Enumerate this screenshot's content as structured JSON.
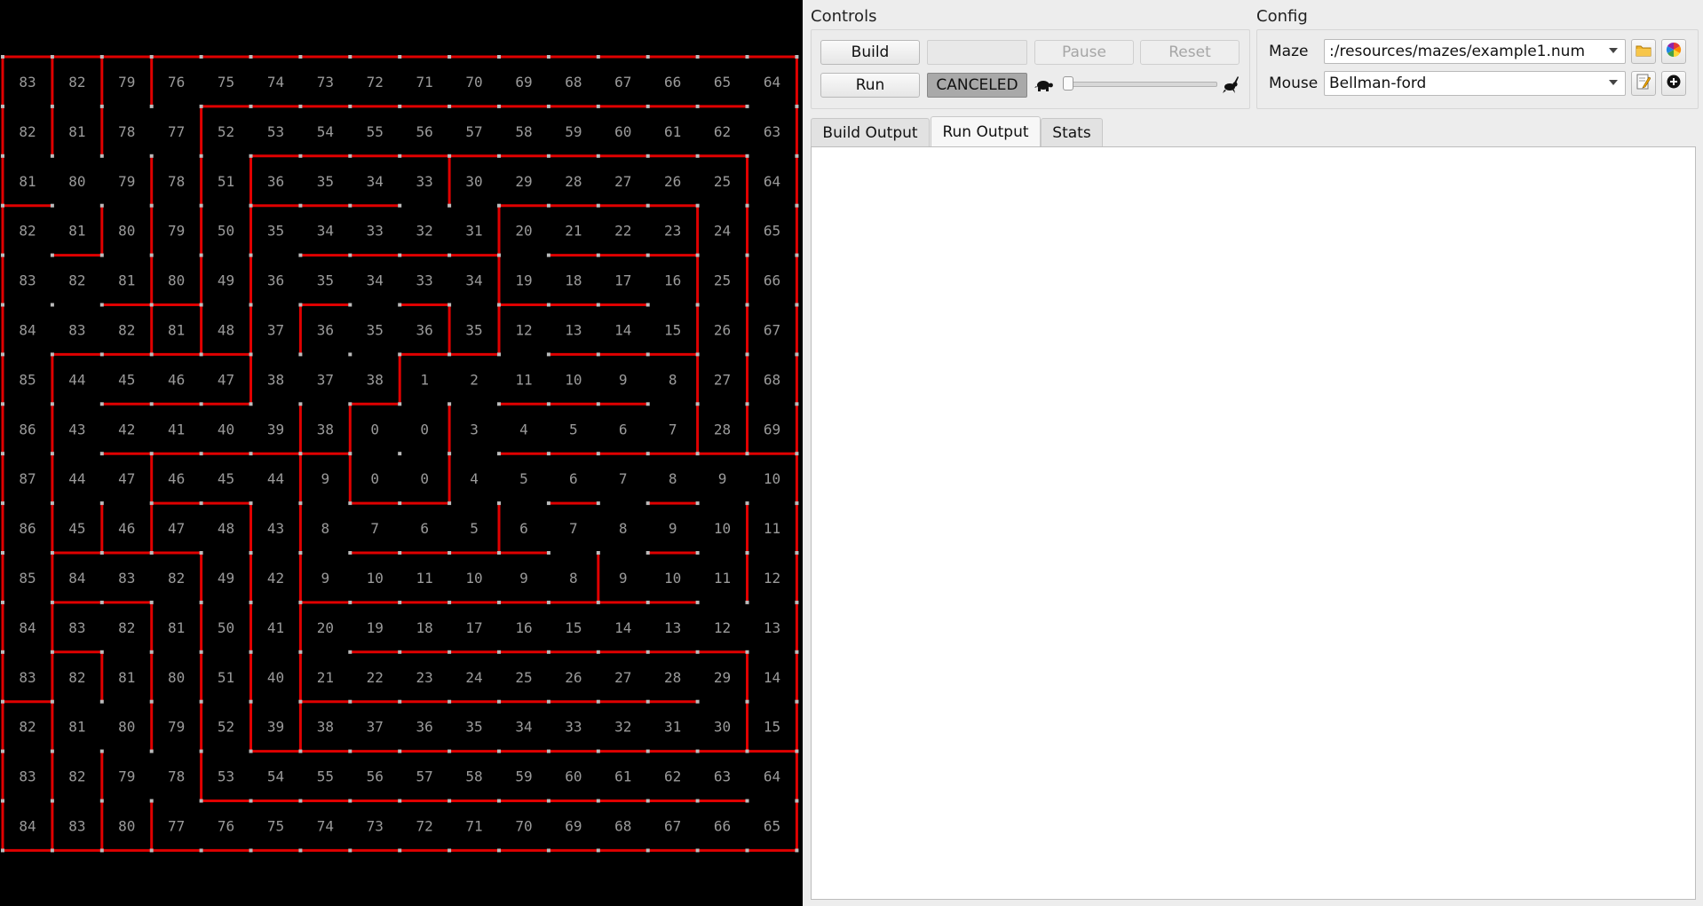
{
  "maze": {
    "rows": [
      [
        "83",
        "82",
        "79",
        "76",
        "75",
        "74",
        "73",
        "72",
        "71",
        "70",
        "69",
        "68",
        "67",
        "66",
        "65",
        "64"
      ],
      [
        "82",
        "81",
        "78",
        "77",
        "52",
        "53",
        "54",
        "55",
        "56",
        "57",
        "58",
        "59",
        "60",
        "61",
        "62",
        "63"
      ],
      [
        "81",
        "80",
        "79",
        "78",
        "51",
        "36",
        "35",
        "34",
        "33",
        "30",
        "29",
        "28",
        "27",
        "26",
        "25",
        "64"
      ],
      [
        "82",
        "81",
        "80",
        "79",
        "50",
        "35",
        "34",
        "33",
        "32",
        "31",
        "20",
        "21",
        "22",
        "23",
        "24",
        "65"
      ],
      [
        "83",
        "82",
        "81",
        "80",
        "49",
        "36",
        "35",
        "34",
        "33",
        "34",
        "19",
        "18",
        "17",
        "16",
        "25",
        "66"
      ],
      [
        "84",
        "83",
        "82",
        "81",
        "48",
        "37",
        "36",
        "35",
        "36",
        "35",
        "12",
        "13",
        "14",
        "15",
        "26",
        "67"
      ],
      [
        "85",
        "44",
        "45",
        "46",
        "47",
        "38",
        "37",
        "38",
        "1",
        "2",
        "11",
        "10",
        "9",
        "8",
        "27",
        "68"
      ],
      [
        "86",
        "43",
        "42",
        "41",
        "40",
        "39",
        "38",
        "0",
        "0",
        "3",
        "4",
        "5",
        "6",
        "7",
        "28",
        "69"
      ],
      [
        "87",
        "44",
        "47",
        "46",
        "45",
        "44",
        "9",
        "0",
        "0",
        "4",
        "5",
        "6",
        "7",
        "8",
        "9",
        "10"
      ],
      [
        "86",
        "45",
        "46",
        "47",
        "48",
        "43",
        "8",
        "7",
        "6",
        "5",
        "6",
        "7",
        "8",
        "9",
        "10",
        "11"
      ],
      [
        "85",
        "84",
        "83",
        "82",
        "49",
        "42",
        "9",
        "10",
        "11",
        "10",
        "9",
        "8",
        "9",
        "10",
        "11",
        "12"
      ],
      [
        "84",
        "83",
        "82",
        "81",
        "50",
        "41",
        "20",
        "19",
        "18",
        "17",
        "16",
        "15",
        "14",
        "13",
        "12",
        "13"
      ],
      [
        "83",
        "82",
        "81",
        "80",
        "51",
        "40",
        "21",
        "22",
        "23",
        "24",
        "25",
        "26",
        "27",
        "28",
        "29",
        "14"
      ],
      [
        "82",
        "81",
        "80",
        "79",
        "52",
        "39",
        "38",
        "37",
        "36",
        "35",
        "34",
        "33",
        "32",
        "31",
        "30",
        "15"
      ],
      [
        "83",
        "82",
        "79",
        "78",
        "53",
        "54",
        "55",
        "56",
        "57",
        "58",
        "59",
        "60",
        "61",
        "62",
        "63",
        "64"
      ],
      [
        "84",
        "83",
        "80",
        "77",
        "76",
        "75",
        "74",
        "73",
        "72",
        "71",
        "70",
        "69",
        "68",
        "67",
        "66",
        "65"
      ]
    ],
    "wall_color": "#e00000",
    "post_color": "#bbbbbb",
    "text_color": "#9a9a9a",
    "background": "#000000"
  },
  "controls": {
    "title": "Controls",
    "build_label": "Build",
    "build_field_value": "",
    "pause_label": "Pause",
    "reset_label": "Reset",
    "run_label": "Run",
    "status_label": "CANCELED",
    "speed_slider_value": 0,
    "slow_icon": "turtle-icon",
    "fast_icon": "rabbit-icon"
  },
  "config": {
    "title": "Config",
    "maze_label": "Maze",
    "maze_value": ":/resources/mazes/example1.num",
    "mouse_label": "Mouse",
    "mouse_value": "Bellman-ford",
    "icons": [
      "folder-icon",
      "color-wheel-icon",
      "edit-icon",
      "add-icon"
    ]
  },
  "tabs": [
    {
      "label": "Build Output",
      "active": false
    },
    {
      "label": "Run Output",
      "active": true
    },
    {
      "label": "Stats",
      "active": false
    }
  ],
  "output_text": ""
}
